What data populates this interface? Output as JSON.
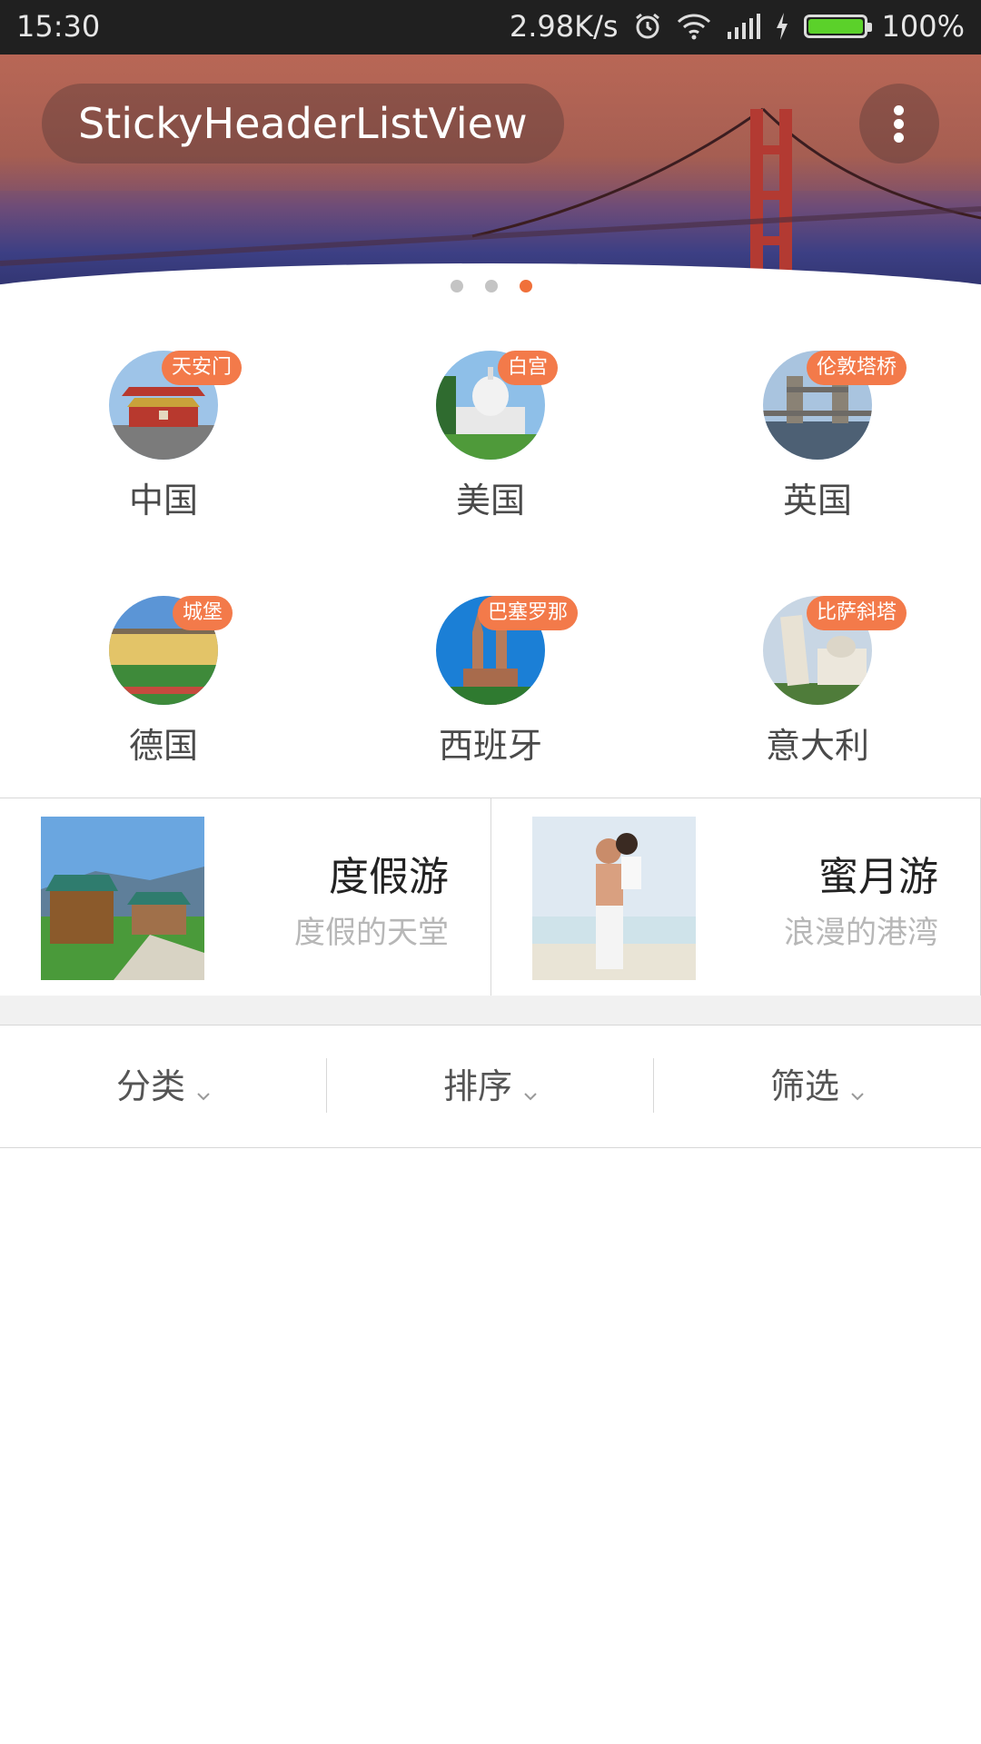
{
  "status_bar": {
    "time": "15:30",
    "network_speed": "2.98K/s",
    "battery": "100%",
    "battery_level": 1.0,
    "icons": [
      "alarm-icon",
      "wifi-icon",
      "signal-icon",
      "charging-icon",
      "battery-icon"
    ]
  },
  "toolbar": {
    "title": "StickyHeaderListView",
    "overflow_icon": "more-vert-icon"
  },
  "carousel": {
    "page_count": 3,
    "active_index": 2,
    "accent": "#f0703a"
  },
  "destinations": [
    {
      "country": "中国",
      "badge": "天安门"
    },
    {
      "country": "美国",
      "badge": "白宫"
    },
    {
      "country": "英国",
      "badge": "伦敦塔桥"
    },
    {
      "country": "德国",
      "badge": "城堡"
    },
    {
      "country": "西班牙",
      "badge": "巴塞罗那"
    },
    {
      "country": "意大利",
      "badge": "比萨斜塔"
    }
  ],
  "promos": [
    {
      "title": "度假游",
      "subtitle": "度假的天堂"
    },
    {
      "title": "蜜月游",
      "subtitle": "浪漫的港湾"
    }
  ],
  "filters": [
    {
      "label": "分类"
    },
    {
      "label": "排序"
    },
    {
      "label": "筛选"
    }
  ],
  "colors": {
    "badge": "#f37a4a",
    "text_primary": "#222222",
    "text_secondary": "#b7b7b7"
  }
}
